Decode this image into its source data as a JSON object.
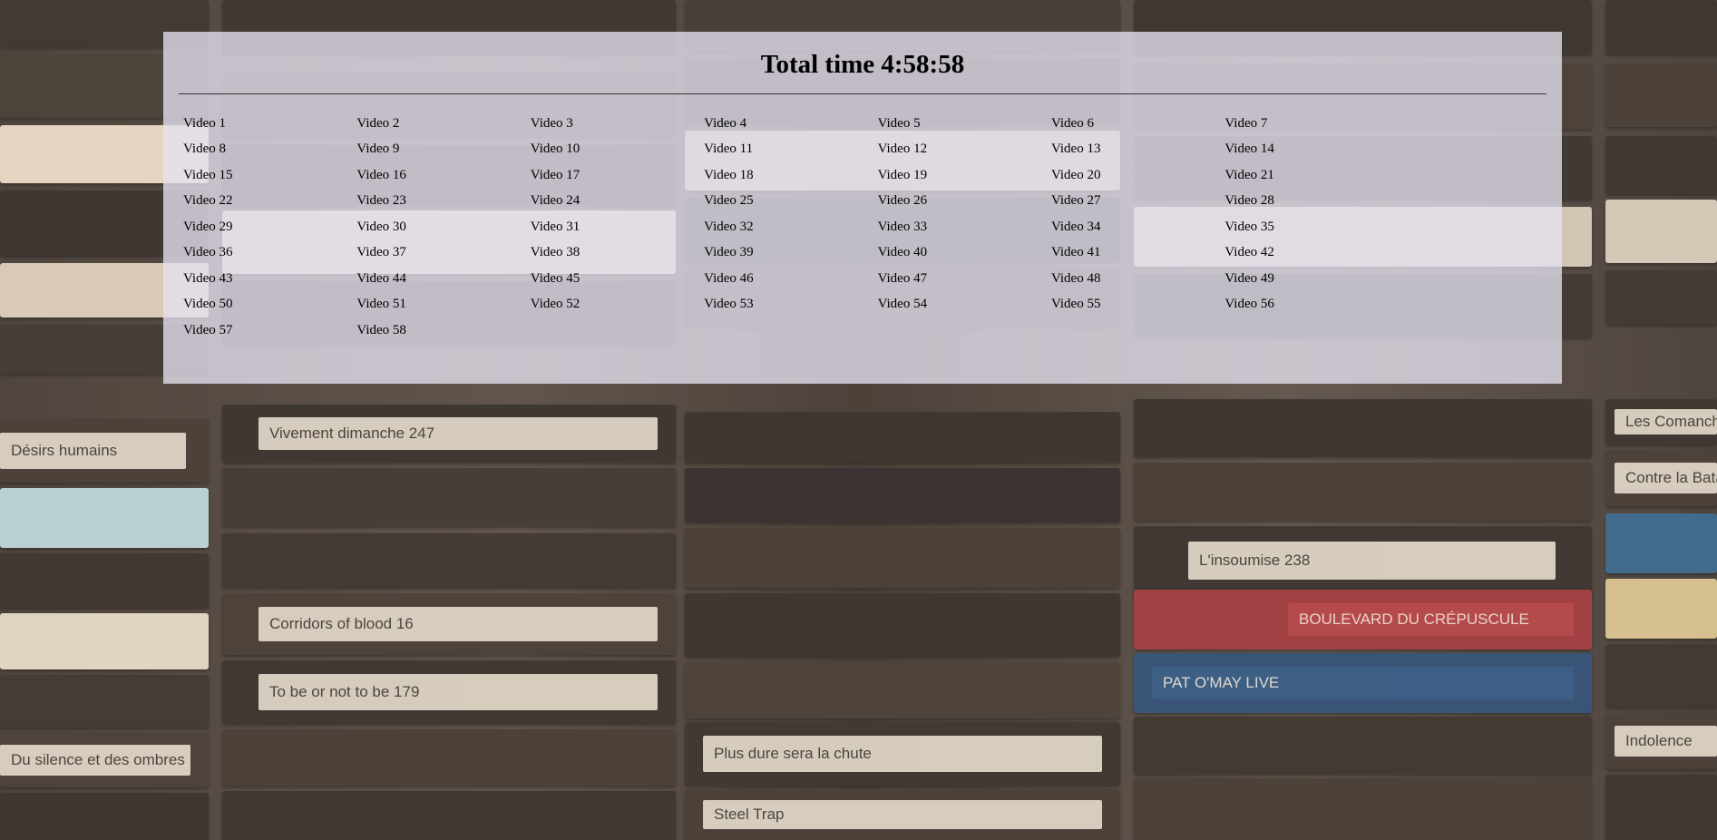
{
  "header": {
    "total_time": "Total time 4:58:58"
  },
  "videos": [
    "Video 1",
    "Video 2",
    "Video 3",
    "Video 4",
    "Video 5",
    "Video 6",
    "Video 7",
    "Video 8",
    "Video 9",
    "Video 10",
    "Video 11",
    "Video 12",
    "Video 13",
    "Video 14",
    "Video 15",
    "Video 16",
    "Video 17",
    "Video 18",
    "Video 19",
    "Video 20",
    "Video 21",
    "Video 22",
    "Video 23",
    "Video 24",
    "Video 25",
    "Video 26",
    "Video 27",
    "Video 28",
    "Video 29",
    "Video 30",
    "Video 31",
    "Video 32",
    "Video 33",
    "Video 34",
    "Video 35",
    "Video 36",
    "Video 37",
    "Video 38",
    "Video 39",
    "Video 40",
    "Video 41",
    "Video 42",
    "Video 43",
    "Video 44",
    "Video 45",
    "Video 46",
    "Video 47",
    "Video 48",
    "Video 49",
    "Video 50",
    "Video 51",
    "Video 52",
    "Video 53",
    "Video 54",
    "Video 55",
    "Video 56",
    "Video 57",
    "Video 58"
  ],
  "background": {
    "tape_labels": [
      "Vivement dimanche 247",
      "Corridors of blood 16",
      "To be or not to be 179",
      "Steel Trap",
      "Plus dure sera la chute",
      "L'insoumise 238",
      "PAT O'MAY LIVE",
      "BOULEVARD DU CRÉPUSCULE",
      "Désirs humains",
      "Du silence et des ombres",
      "Indolence",
      "Les Comancheros",
      "Contre la Bataille"
    ]
  },
  "colors": {
    "panel": "#e6e2f0",
    "text": "#000000",
    "rule": "#333333"
  }
}
